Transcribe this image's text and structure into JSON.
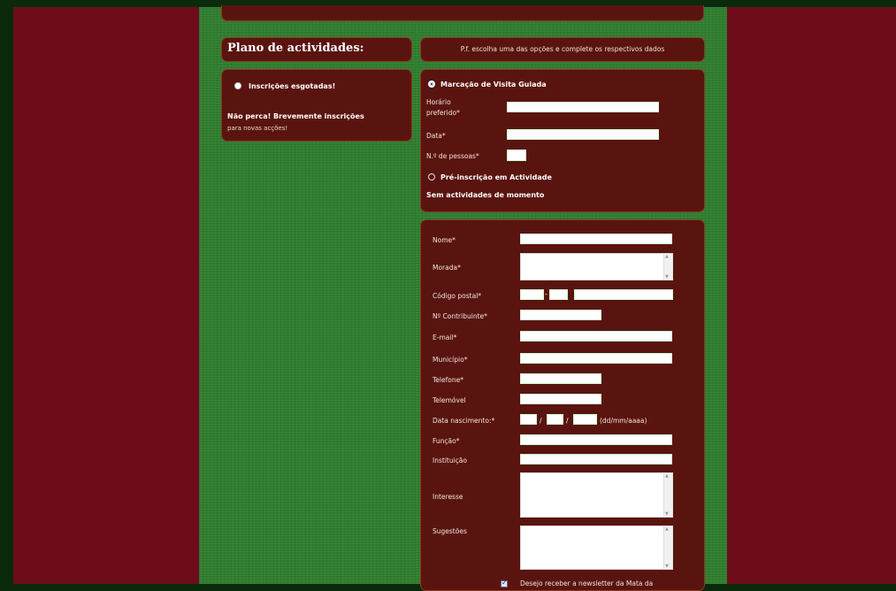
{
  "colors": {
    "page_bg": "#0b2a0b",
    "outer_bg": "#6e0c1a",
    "grass": "#2f7d2f",
    "panel": "#5a1410"
  },
  "plan": {
    "title": "Plano de actividades:",
    "hint": "P.f. escolha uma das opções e complete os respectivos dados"
  },
  "left": {
    "closed_label": "Inscrições esgotadas!",
    "soon_line1": "Não perca! Brevemente inscrições",
    "soon_line2": "para novas acções!"
  },
  "select": {
    "option1_label": "Marcação de Visita Guiada",
    "horario_label_1": "Horário",
    "horario_label_2": "preferido*",
    "data_label": "Data*",
    "pessoas_label": "N.º de pessoas*",
    "option2_label": "Pré-inscrição em Actividade",
    "none_msg": "Sem actividades de momento"
  },
  "form": {
    "nome": "Nome*",
    "morada": "Morada*",
    "codigo_postal": "Código postal*",
    "contribuinte": "Nº Contribuinte*",
    "email": "E-mail*",
    "municipio": "Município*",
    "telefone": "Telefone*",
    "telemovel": "Telemóvel",
    "data_nascimento": "Data nascimento:*",
    "date_sep": "/",
    "date_hint": "(dd/mm/aaaa)",
    "funcao": "Função*",
    "instituicao": "Instituição",
    "interesse": "Interesse",
    "sugestoes": "Sugestões",
    "consent_text": "Desejo receber a newsletter da Mata da"
  }
}
